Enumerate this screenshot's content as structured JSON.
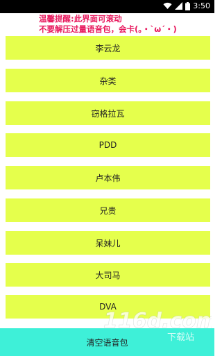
{
  "statusbar": {
    "time": "3:50",
    "icons": [
      "wifi-icon",
      "signal-icon",
      "battery-icon"
    ]
  },
  "tip": {
    "line1": "温馨提醒:此界面可滚动",
    "line2": "不要解压过量语音包，会卡(。・`ω´・)"
  },
  "items": [
    {
      "label": "李云龙"
    },
    {
      "label": "杂类"
    },
    {
      "label": "窃格拉瓦"
    },
    {
      "label": "PDD"
    },
    {
      "label": "卢本伟"
    },
    {
      "label": "兄贵"
    },
    {
      "label": "呆妹儿"
    },
    {
      "label": "大司马"
    },
    {
      "label": "DVA"
    }
  ],
  "bottom_button": {
    "label": "清空语音包"
  },
  "watermark": {
    "text": "116d.com",
    "sub": "下载站"
  },
  "colors": {
    "item_bg": "#e5ff4c",
    "bottom_bg": "#3ef0d8",
    "tip_text": "#e8195e",
    "statusbar_bg": "#000000"
  }
}
